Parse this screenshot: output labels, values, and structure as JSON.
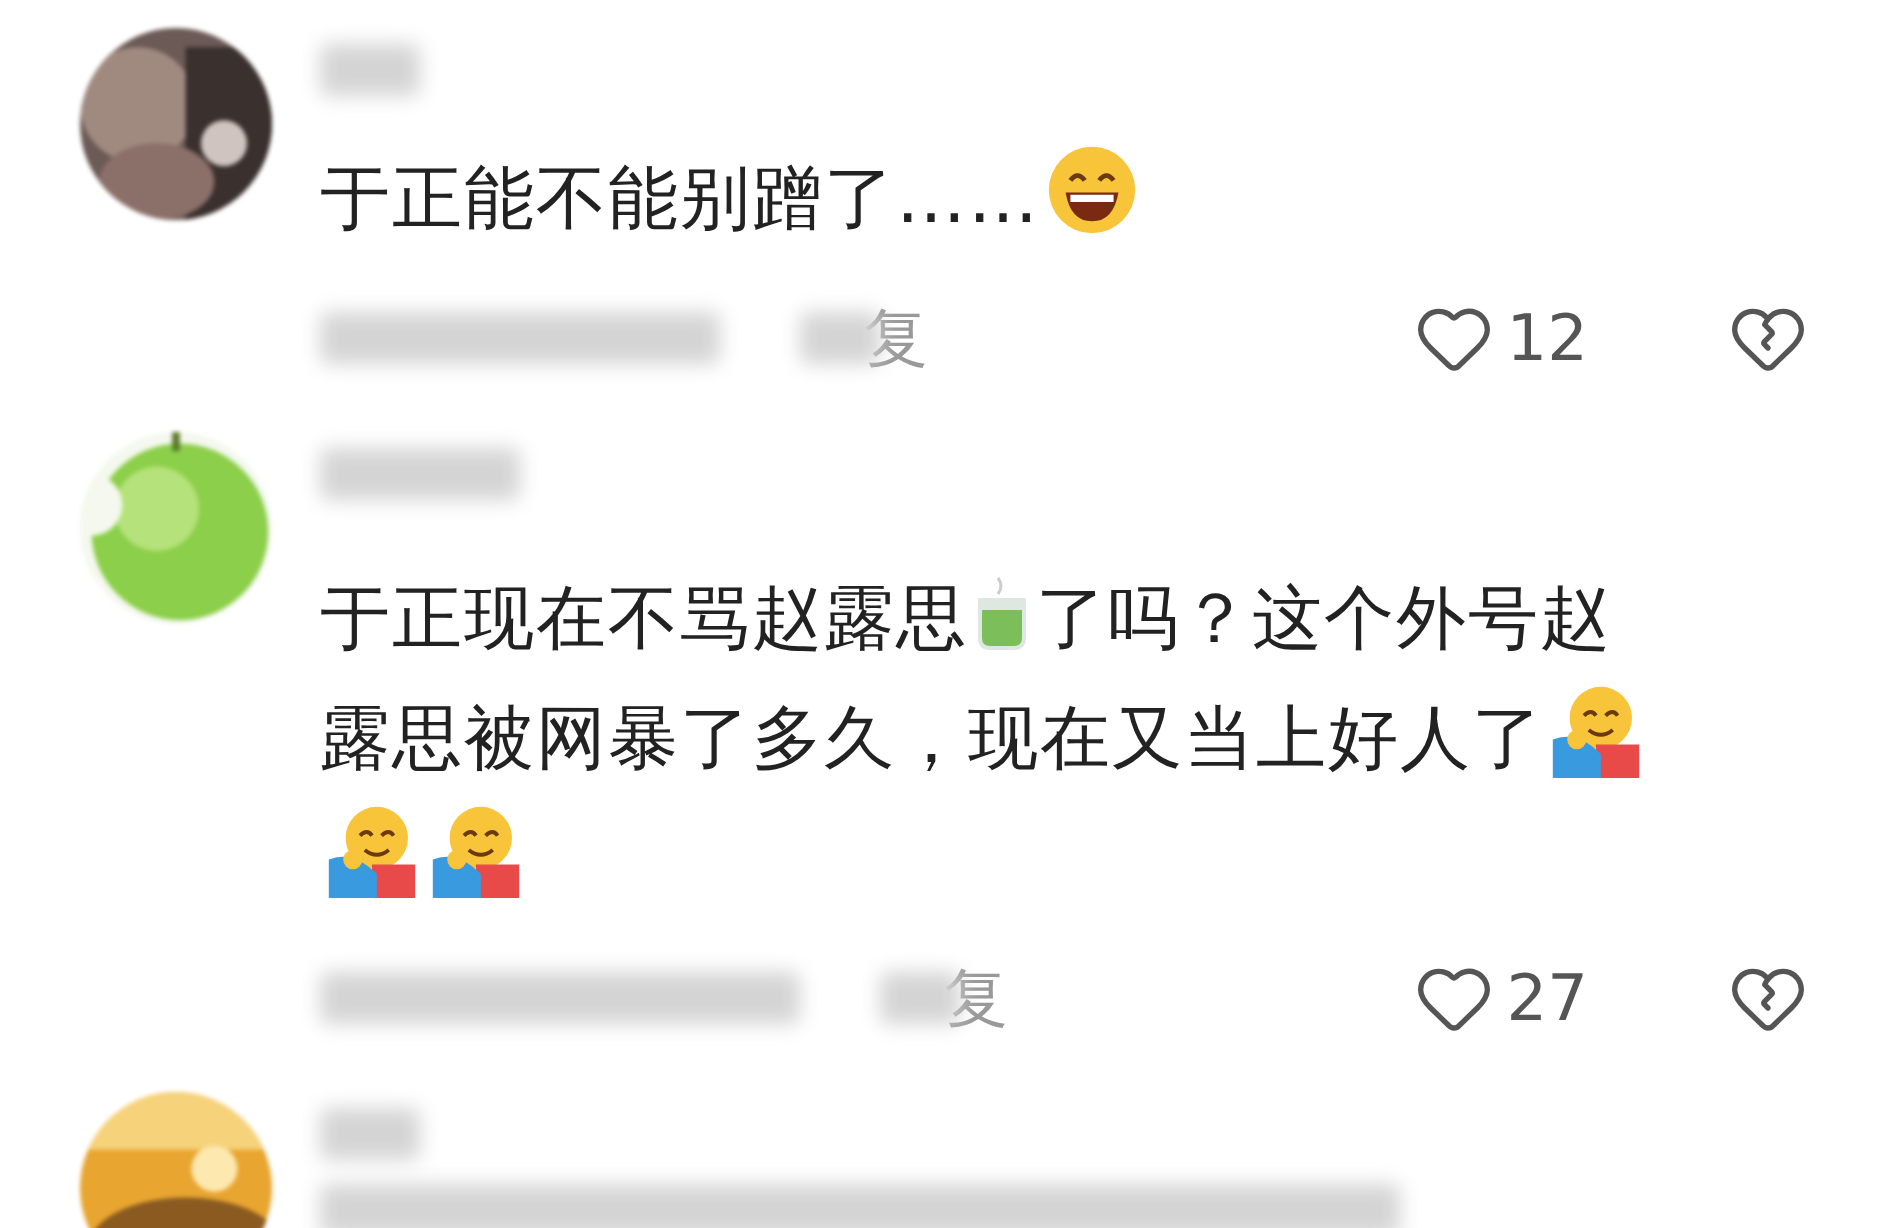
{
  "comments": [
    {
      "avatar": {
        "kind": "picture"
      },
      "segments": [
        {
          "kind": "text",
          "text": "于正能不能别蹭了……"
        },
        {
          "kind": "grin-emoji"
        }
      ],
      "reply_label": "复",
      "likes": "12"
    },
    {
      "avatar": {
        "kind": "picture"
      },
      "segments": [
        {
          "kind": "text",
          "text": "于正现在不骂赵露思"
        },
        {
          "kind": "tea-emoji"
        },
        {
          "kind": "text",
          "text": "了吗？这个外号赵"
        },
        {
          "kind": "text",
          "text": "露思被网暴了多久，现在又当上好人了"
        },
        {
          "kind": "hug-emoji"
        },
        {
          "kind": "hug-emoji"
        },
        {
          "kind": "hug-emoji"
        }
      ],
      "reply_label": "复",
      "likes": "27"
    },
    {
      "avatar": {
        "kind": "picture"
      }
    }
  ]
}
